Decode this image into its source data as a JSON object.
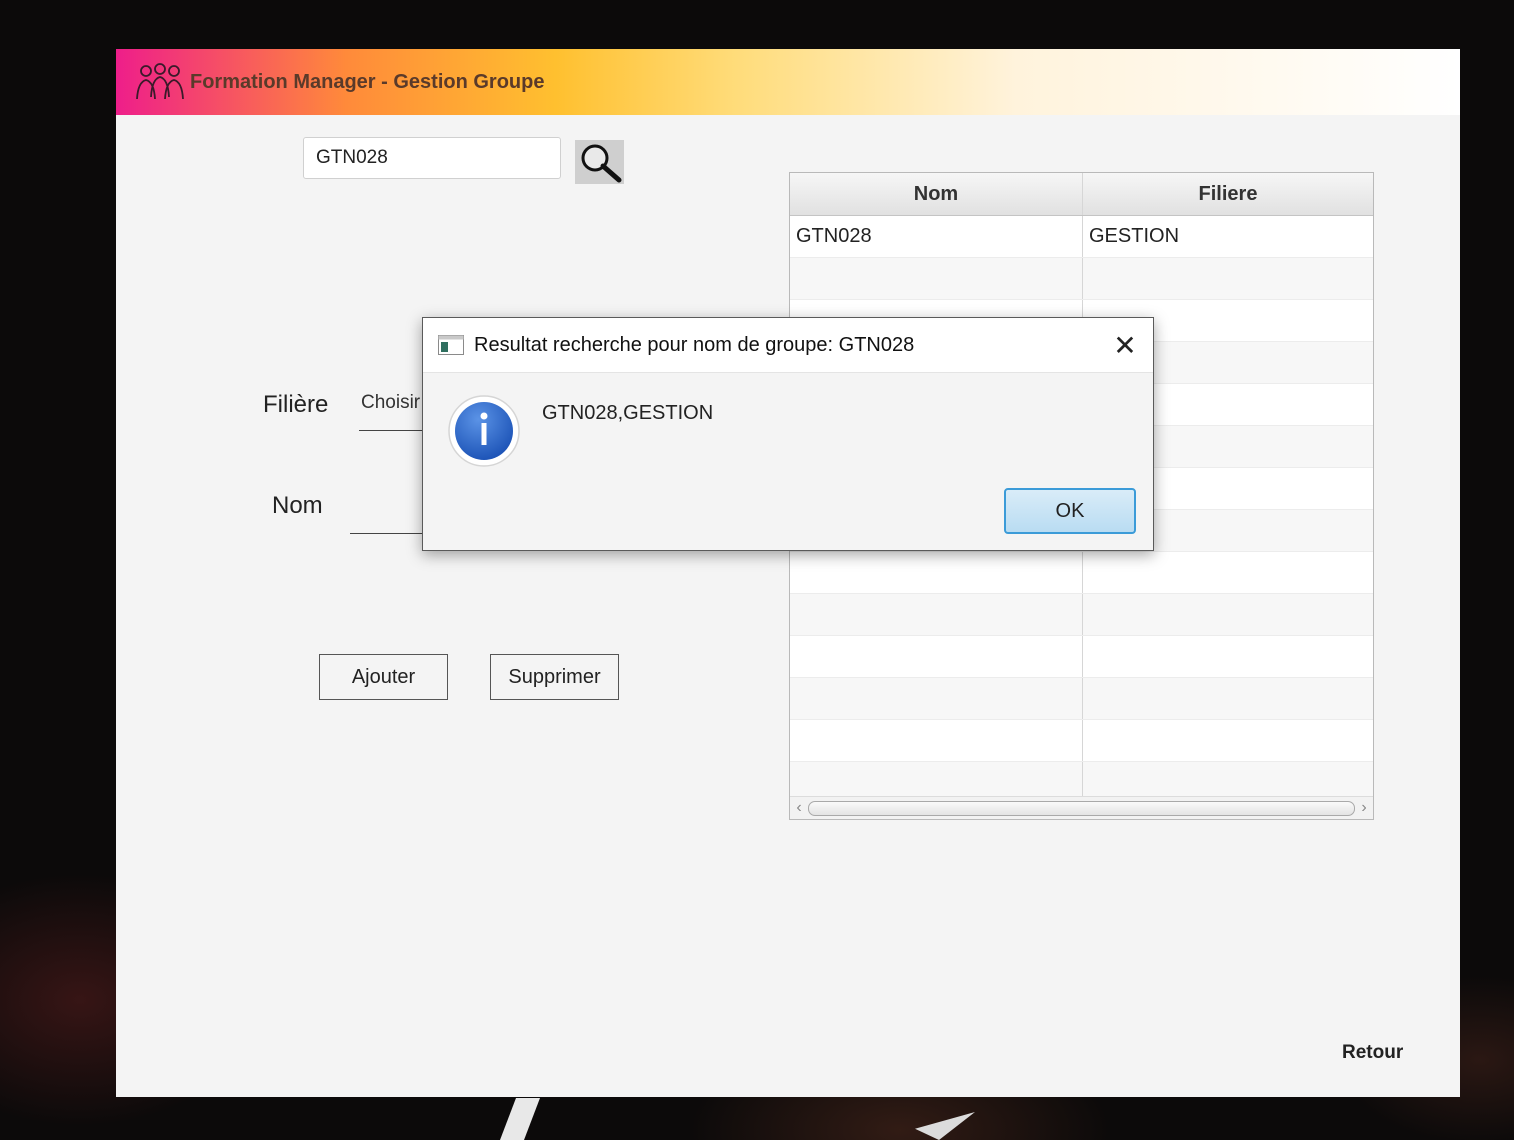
{
  "window": {
    "title": "Formation Manager - Gestion Groupe",
    "logo_icon": "people-group-icon"
  },
  "search": {
    "value": "GTN028",
    "button_icon": "magnifier-icon"
  },
  "form": {
    "filiere_label": "Filière",
    "filiere_select_text": "Choisir",
    "nom_label": "Nom",
    "nom_value": ""
  },
  "buttons": {
    "ajouter": "Ajouter",
    "supprimer": "Supprimer"
  },
  "table": {
    "columns": [
      "Nom",
      "Filiere"
    ],
    "rows": [
      [
        "GTN028",
        "GESTION"
      ]
    ]
  },
  "retour": "Retour",
  "dialog": {
    "title": "Resultat recherche pour nom de groupe:  GTN028",
    "message": "GTN028,GESTION",
    "ok": "OK",
    "icon": "info-icon",
    "close_icon": "close-icon"
  }
}
